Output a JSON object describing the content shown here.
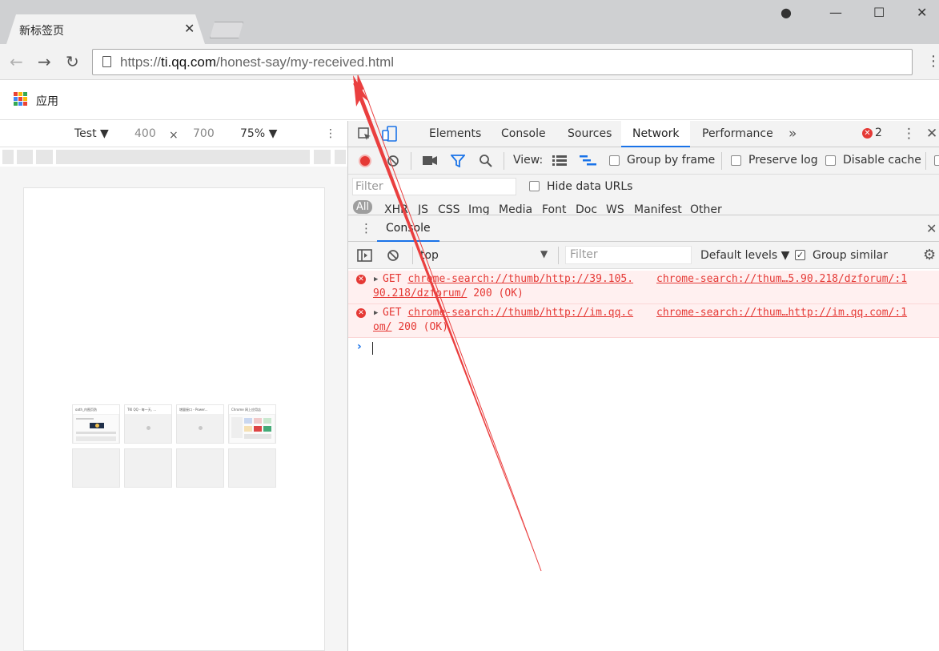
{
  "browser": {
    "tab_title": "新标签页",
    "tab_close": "✕",
    "window_controls": {
      "user": "●",
      "minimize": "—",
      "maximize": "☐",
      "close": "✕"
    },
    "nav": {
      "back": "←",
      "forward": "→",
      "reload": "↻"
    },
    "url": {
      "scheme": "https://",
      "host": "ti.qq.com",
      "path": "/honest-say/my-received.html"
    },
    "menu": "⋮",
    "bookmarks": {
      "apps_label": "应用"
    }
  },
  "device_toolbar": {
    "device": "Test ▼",
    "width": "400",
    "times": "×",
    "height": "700",
    "zoom": "75% ▼",
    "more": "⋮"
  },
  "tiles": [
    {
      "title": "oath_内图页防",
      "kind": "screenshot"
    },
    {
      "title": "TKI QQ - 每一天, ...",
      "kind": "dot"
    },
    {
      "title": "增量接口 - Power...",
      "kind": "dot"
    },
    {
      "title": "Chrome 网上应用店",
      "kind": "screenshot"
    }
  ],
  "devtools": {
    "tabs": [
      "Elements",
      "Console",
      "Sources",
      "Network",
      "Performance"
    ],
    "active_tab": "Network",
    "overflow": "»",
    "error_count": "2",
    "network": {
      "view_label": "View:",
      "group_by_frame": "Group by frame",
      "preserve_log": "Preserve log",
      "disable_cache": "Disable cache",
      "filter_placeholder": "Filter",
      "hide_data_urls": "Hide data URLs",
      "types": [
        "All",
        "XHR",
        "JS",
        "CSS",
        "Img",
        "Media",
        "Font",
        "Doc",
        "WS",
        "Manifest",
        "Other"
      ]
    },
    "drawer": {
      "tab": "Console",
      "context": "top",
      "filter_placeholder": "Filter",
      "levels": "Default levels ▼",
      "group_similar": "Group similar",
      "messages": [
        {
          "method": "GET",
          "url_start": "chrome-search://thumb/http://39.105.",
          "url_cont": "90.218/dzforum/",
          "status": "200 (OK)",
          "source_pre": "chrome-search://thum…5.90.218/dzforum/:1"
        },
        {
          "method": "GET",
          "url_start": "chrome-search://thumb/http://im.qq.c",
          "url_cont": "om/",
          "status": "200 (OK)",
          "source_pre": "chrome-search://thum…http://im.qq.com/:1"
        }
      ],
      "prompt": "›"
    }
  },
  "colors": {
    "accent": "#1a73e8",
    "error": "#e53935",
    "annotation": "#ea3f3f"
  }
}
